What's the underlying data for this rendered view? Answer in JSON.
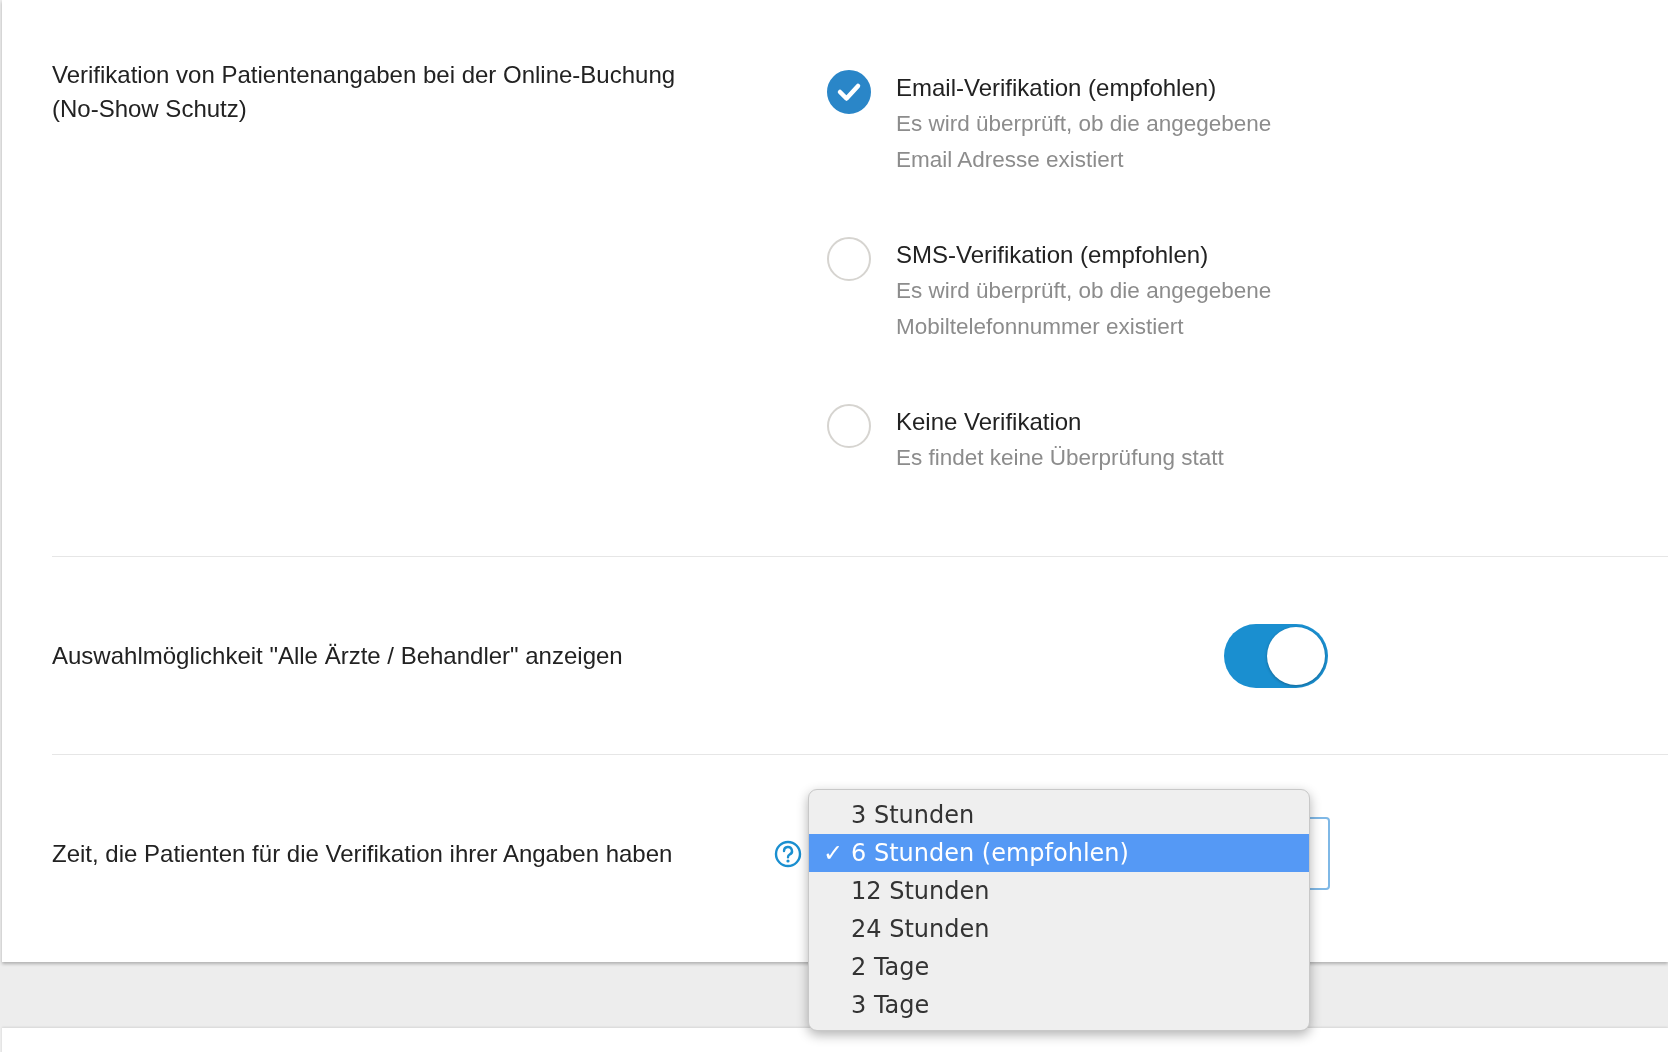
{
  "verification": {
    "label": "Verifikation von Patientenangaben bei der Online-Buchung (No-Show Schutz)",
    "options": [
      {
        "title": "Email-Verifikation (empfohlen)",
        "description": "Es wird überprüft, ob die angegebene Email Adresse existiert",
        "selected": true
      },
      {
        "title": "SMS-Verifikation (empfohlen)",
        "description": "Es wird überprüft, ob die angegebene Mobiltelefonnummer existiert",
        "selected": false
      },
      {
        "title": "Keine Verifikation",
        "description": "Es findet keine Überprüfung statt",
        "selected": false
      }
    ]
  },
  "show_all_doctors": {
    "label": "Auswahlmöglichkeit \"Alle Ärzte / Behandler\" anzeigen",
    "on": true
  },
  "verification_time": {
    "label": "Zeit, die Patienten für die Verifikation ihrer Angaben haben",
    "check_mark": "✓",
    "options": [
      {
        "label": "3 Stunden",
        "selected": false
      },
      {
        "label": "6 Stunden (empfohlen)",
        "selected": true
      },
      {
        "label": "12 Stunden",
        "selected": false
      },
      {
        "label": "24 Stunden",
        "selected": false
      },
      {
        "label": "2 Tage",
        "selected": false
      },
      {
        "label": "3 Tage",
        "selected": false
      }
    ]
  }
}
